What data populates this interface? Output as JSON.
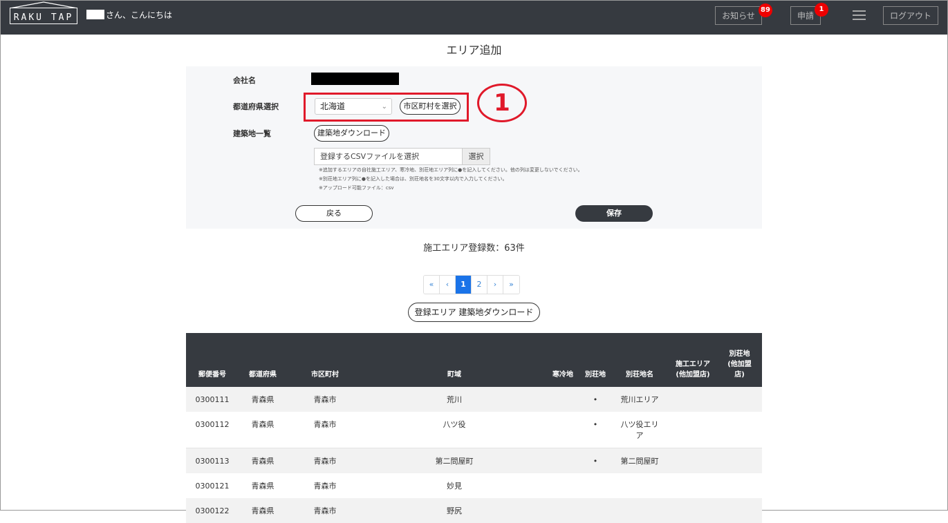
{
  "header": {
    "logo": "RAKU TAP",
    "greeting": "さん、こんにちは",
    "notice_label": "お知らせ",
    "notice_badge": "89",
    "apply_label": "申請",
    "apply_badge": "1",
    "logout_label": "ログアウト"
  },
  "page_title": "エリア追加",
  "form": {
    "company_label": "会社名",
    "pref_label": "都道府県選択",
    "pref_value": "北海道",
    "city_button": "市区町村を選択",
    "annotation_number": "1",
    "building_label": "建築地一覧",
    "building_download": "建築地ダウンロード",
    "csv_placeholder": "登録するCSVファイルを選択",
    "csv_button": "選択",
    "notes": [
      "※追加するエリアの自社施工エリア、寒冷地、別荘地エリア列に●を記入してください。他の列は変更しないでください。",
      "※別荘地エリア列に●を記入した場合は、別荘地名を30文字以内で入力してください。",
      "※アップロード可能ファイル：csv"
    ],
    "back_button": "戻る",
    "save_button": "保存"
  },
  "count_text": "施工エリア登録数：63件",
  "pagination": [
    "«",
    "‹",
    "1",
    "2",
    "›",
    "»"
  ],
  "download_area_button": "登録エリア 建築地ダウンロード",
  "table": {
    "headers": [
      "郵便番号",
      "都道府県",
      "市区町村",
      "町域",
      "寒冷地",
      "別荘地",
      "別荘地名",
      "施工エリア\n(他加盟店)",
      "別荘地\n(他加盟\n店)"
    ],
    "rows": [
      [
        "0300111",
        "青森県",
        "青森市",
        "荒川",
        "",
        "•",
        "荒川エリア",
        "",
        ""
      ],
      [
        "0300112",
        "青森県",
        "青森市",
        "八ツ役",
        "",
        "•",
        "八ツ役エリ\nア",
        "",
        ""
      ],
      [
        "0300113",
        "青森県",
        "青森市",
        "第二問屋町",
        "",
        "•",
        "第二問屋町",
        "",
        ""
      ],
      [
        "0300121",
        "青森県",
        "青森市",
        "妙見",
        "",
        "",
        "",
        "",
        ""
      ],
      [
        "0300122",
        "青森県",
        "青森市",
        "野尻",
        "",
        "",
        "",
        "",
        ""
      ]
    ]
  }
}
